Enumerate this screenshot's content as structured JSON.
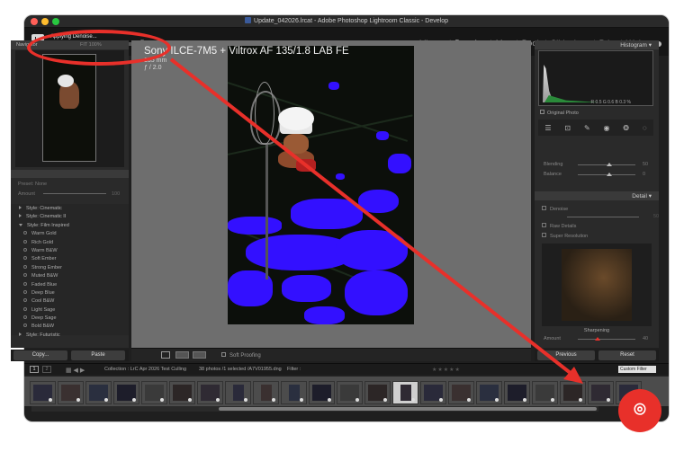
{
  "window": {
    "title": "Update_042026.lrcat - Adobe Photoshop Lightroom Classic - Develop"
  },
  "topbar": {
    "logo": "Lr",
    "job": {
      "label": "Applying Denoise...",
      "progress": 0.85,
      "close": "×"
    },
    "modules": [
      "Library",
      "Develop",
      "Map",
      "Book",
      "Slideshow",
      "Print",
      "Web"
    ],
    "active_module": "Develop",
    "separator": "|"
  },
  "left_panel": {
    "navigator": {
      "header": "Navigator",
      "zoom_labels": "FIT 100%"
    },
    "preset_amount": {
      "label": "Preset: None",
      "amount_label": "Amount",
      "amount_value": "100"
    },
    "presets": [
      {
        "kind": "group",
        "label": "Style: Cinematic",
        "open": false
      },
      {
        "kind": "group",
        "label": "Style: Cinematic II",
        "open": false
      },
      {
        "kind": "group",
        "label": "Style: Film Inspired",
        "open": true
      },
      {
        "kind": "preset",
        "label": "Warm Gold"
      },
      {
        "kind": "preset",
        "label": "Rich Gold"
      },
      {
        "kind": "preset",
        "label": "Warm B&W"
      },
      {
        "kind": "preset",
        "label": "Soft Ember"
      },
      {
        "kind": "preset",
        "label": "Strong Ember"
      },
      {
        "kind": "preset",
        "label": "Muted B&W"
      },
      {
        "kind": "preset",
        "label": "Faded Blue"
      },
      {
        "kind": "preset",
        "label": "Deep Blue"
      },
      {
        "kind": "preset",
        "label": "Cool B&W"
      },
      {
        "kind": "preset",
        "label": "Light Sage"
      },
      {
        "kind": "preset",
        "label": "Deep Sage"
      },
      {
        "kind": "preset",
        "label": "Bold B&W"
      },
      {
        "kind": "group",
        "label": "Style: Futuristic",
        "open": false
      }
    ],
    "buttons": {
      "copy": "Copy...",
      "paste": "Paste"
    }
  },
  "center": {
    "info": {
      "camera_lens": "Sony ILCE-7M5 + Viltrox AF 135/1.8 LAB FE",
      "focal": "135 mm",
      "aperture": "ƒ / 2.0"
    },
    "toolbar": {
      "soft_proofing": "Soft Proofing"
    }
  },
  "right_panel": {
    "histogram": {
      "header": "Histogram",
      "readout": "R  0.5  G  0.6  B  0.3 %",
      "original_photo": "Original Photo"
    },
    "sliders": [
      {
        "label": "Blending",
        "value": "50",
        "pos": 0.5
      },
      {
        "label": "Balance",
        "value": "0",
        "pos": 0.5
      }
    ],
    "detail": {
      "header": "Detail",
      "denoise": {
        "label": "Denoise",
        "value": "50"
      },
      "raw_details": "Raw Details",
      "super_resolution": "Super Resolution",
      "sharpening": {
        "header": "Sharpening",
        "amount_label": "Amount",
        "amount_value": "40",
        "pos": 0.3
      }
    },
    "buttons": {
      "previous": "Previous",
      "reset": "Reset"
    }
  },
  "filmstrip_bar": {
    "pages": [
      "1",
      "2"
    ],
    "collection": "Collection : LrC Apr 2026 Test Culling",
    "count": "38 photos /1 selected /A7V01955.dng",
    "filter_label": "Filter :",
    "custom_filter": "Custom Filter"
  },
  "filmstrip": {
    "thumb_count": 22,
    "selected_index": 13
  },
  "overlay": {
    "logo_glyph": "⌾",
    "annotation_color": "#e8302a"
  }
}
